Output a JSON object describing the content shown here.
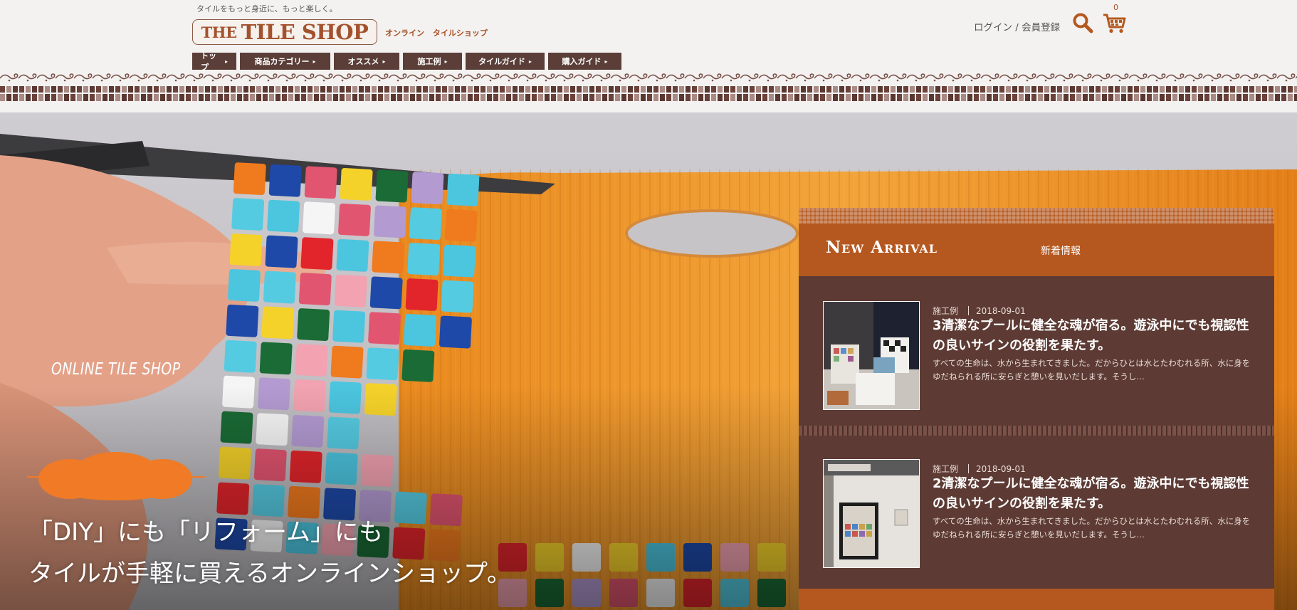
{
  "header": {
    "tagline": "タイルをもっと身近に、もっと楽しく。",
    "logo_the": "THE",
    "logo_main": "TILE SHOP",
    "sublogo": "オンライン タイルショップ",
    "login": "ログイン / 会員登録",
    "cart_count": "0"
  },
  "nav": {
    "items": [
      {
        "label": "トップ"
      },
      {
        "label": "商品カテゴリー"
      },
      {
        "label": "オススメ"
      },
      {
        "label": "施工例"
      },
      {
        "label": "タイルガイド"
      },
      {
        "label": "購入ガイド"
      }
    ],
    "arrow": "▸"
  },
  "hero": {
    "badge": "ONLINE TILE SHOP",
    "line1": "「DIY」にも「リフォーム」にも",
    "line2": "タイルが手軽に買えるオンラインショップ。"
  },
  "news": {
    "title": "New Arrival",
    "subtitle": "新着情報",
    "items": [
      {
        "category": "施工例",
        "date": "2018-09-01",
        "headline": "3清潔なプールに健全な魂が宿る。遊泳中にでも視認性の良いサインの役割を果たす。",
        "excerpt": "すべての生命は、水から生まれてきました。だからひとは水とたわむれる所、水に身をゆだねられる所に安らぎと憩いを見いだします。そうし…"
      },
      {
        "category": "施工例",
        "date": "2018-09-01",
        "headline": "2清潔なプールに健全な魂が宿る。遊泳中にでも視認性の良いサインの役割を果たす。",
        "excerpt": "すべての生命は、水から生まれてきました。だからひとは水とたわむれる所、水に身をゆだねられる所に安らぎと憩いを見いだします。そうし…"
      }
    ]
  },
  "colors": {
    "brand": "#a3522e",
    "nav_bg": "#5a3e37",
    "news_bg": "#5d3b34",
    "news_header": "#b5581f",
    "badge": "#f07a25"
  }
}
